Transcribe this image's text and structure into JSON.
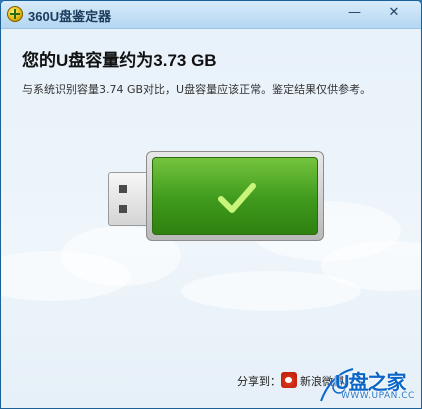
{
  "titlebar": {
    "title": "360U盘鉴定器",
    "min_symbol": "—",
    "close_symbol": "✕"
  },
  "result": {
    "headline": "您的U盘容量约为3.73 GB",
    "detail": "与系统识别容量3.74 GB对比，U盘容量应该正常。鉴定结果仅供参考。"
  },
  "footer": {
    "share_label": "分享到：",
    "weibo_label": "新浪微博"
  },
  "watermark": {
    "text": "U盘之家",
    "url": "WWW.UPAN.CC"
  },
  "icons": {
    "app": "360-shield-plus-icon",
    "status": "check-icon",
    "share": "sina-weibo-icon"
  },
  "colors": {
    "status_green": "#3f9a1c",
    "check": "#c8f57a",
    "watermark_blue": "#0a66c8"
  }
}
